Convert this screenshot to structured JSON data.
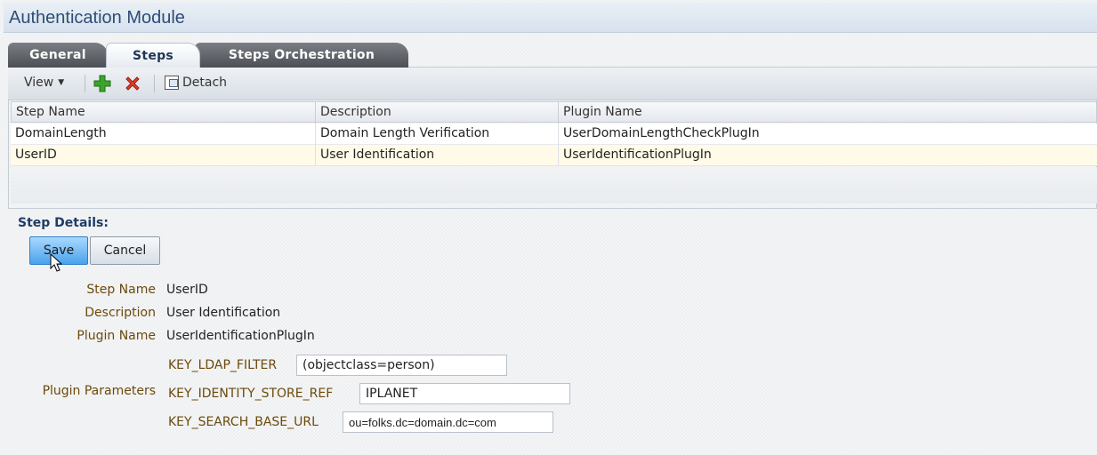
{
  "header": {
    "title": "Authentication Module"
  },
  "tabs": [
    {
      "label": "General"
    },
    {
      "label": "Steps"
    },
    {
      "label": "Steps Orchestration"
    }
  ],
  "active_tab": "Steps",
  "toolbar": {
    "view_label": "View",
    "add_icon": "add-icon",
    "delete_icon": "delete-icon",
    "detach_label": "Detach"
  },
  "grid": {
    "columns": [
      "Step Name",
      "Description",
      "Plugin Name"
    ],
    "rows": [
      [
        "DomainLength",
        "Domain Length Verification",
        "UserDomainLengthCheckPlugIn"
      ],
      [
        "UserID",
        "User Identification",
        "UserIdentificationPlugIn"
      ]
    ],
    "selected_row": "UserID"
  },
  "details": {
    "title": "Step Details:",
    "save_label": "Save",
    "cancel_label": "Cancel",
    "step_name_label": "Step Name",
    "step_name_value": "UserID",
    "description_label": "Description",
    "description_value": "User Identification",
    "plugin_name_label": "Plugin Name",
    "plugin_name_value": "UserIdentificationPlugIn",
    "plugin_params_label": "Plugin Parameters",
    "params": [
      {
        "key": "KEY_LDAP_FILTER",
        "value": "(objectclass=person)"
      },
      {
        "key": "KEY_IDENTITY_STORE_REF",
        "value": "IPLANET"
      },
      {
        "key": "KEY_SEARCH_BASE_URL",
        "value": "ou=folks.dc=domain.dc=com"
      }
    ]
  },
  "colors": {
    "title": "#2f4d76",
    "label": "#6b4a0c",
    "save_button": "#4aa2ec",
    "selected_row": "#fffbe8"
  }
}
